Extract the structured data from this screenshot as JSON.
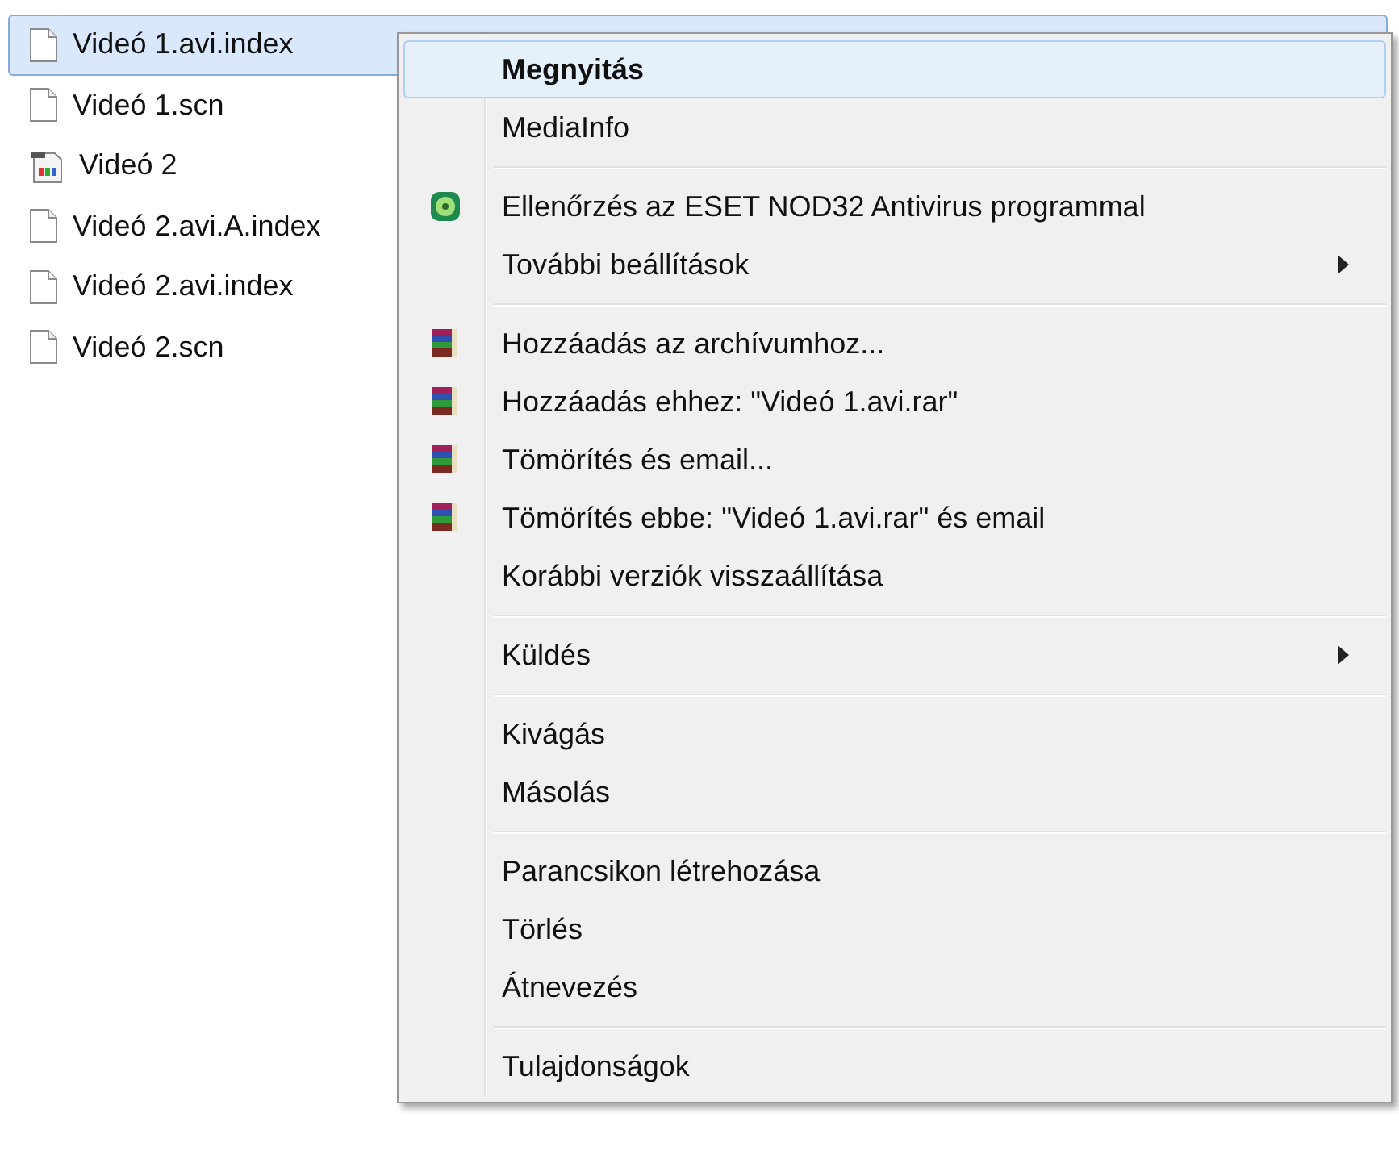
{
  "files": [
    {
      "name": "Videó 1.avi.index",
      "kind": "document",
      "selected": true
    },
    {
      "name": "Videó 1.scn",
      "kind": "document",
      "selected": false
    },
    {
      "name": "Videó 2",
      "kind": "video",
      "selected": false
    },
    {
      "name": "Videó 2.avi.A.index",
      "kind": "document",
      "selected": false
    },
    {
      "name": "Videó 2.avi.index",
      "kind": "document",
      "selected": false
    },
    {
      "name": "Videó 2.scn",
      "kind": "document",
      "selected": false
    }
  ],
  "context_menu": {
    "groups": [
      [
        {
          "label": "Megnyitás",
          "kind": "plain",
          "default": true,
          "submenu": false,
          "selected": true
        },
        {
          "label": "MediaInfo",
          "kind": "plain",
          "default": false,
          "submenu": false,
          "selected": false
        }
      ],
      [
        {
          "label": "Ellenőrzés az ESET NOD32 Antivirus programmal",
          "kind": "antivirus",
          "default": false,
          "submenu": false,
          "selected": false
        },
        {
          "label": "További beállítások",
          "kind": "plain",
          "default": false,
          "submenu": true,
          "selected": false
        }
      ],
      [
        {
          "label": "Hozzáadás az archívumhoz...",
          "kind": "archive",
          "default": false,
          "submenu": false,
          "selected": false
        },
        {
          "label": "Hozzáadás ehhez: \"Videó 1.avi.rar\"",
          "kind": "archive",
          "default": false,
          "submenu": false,
          "selected": false
        },
        {
          "label": "Tömörítés és email...",
          "kind": "archive",
          "default": false,
          "submenu": false,
          "selected": false
        },
        {
          "label": "Tömörítés ebbe: \"Videó 1.avi.rar\" és email",
          "kind": "archive",
          "default": false,
          "submenu": false,
          "selected": false
        },
        {
          "label": "Korábbi verziók visszaállítása",
          "kind": "plain",
          "default": false,
          "submenu": false,
          "selected": false
        }
      ],
      [
        {
          "label": "Küldés",
          "kind": "plain",
          "default": false,
          "submenu": true,
          "selected": false
        }
      ],
      [
        {
          "label": "Kivágás",
          "kind": "plain",
          "default": false,
          "submenu": false,
          "selected": false
        },
        {
          "label": "Másolás",
          "kind": "plain",
          "default": false,
          "submenu": false,
          "selected": false
        }
      ],
      [
        {
          "label": "Parancsikon létrehozása",
          "kind": "plain",
          "default": false,
          "submenu": false,
          "selected": false
        },
        {
          "label": "Törlés",
          "kind": "plain",
          "default": false,
          "submenu": false,
          "selected": false
        },
        {
          "label": "Átnevezés",
          "kind": "plain",
          "default": false,
          "submenu": false,
          "selected": false
        }
      ],
      [
        {
          "label": "Tulajdonságok",
          "kind": "plain",
          "default": false,
          "submenu": false,
          "selected": false
        }
      ]
    ]
  }
}
